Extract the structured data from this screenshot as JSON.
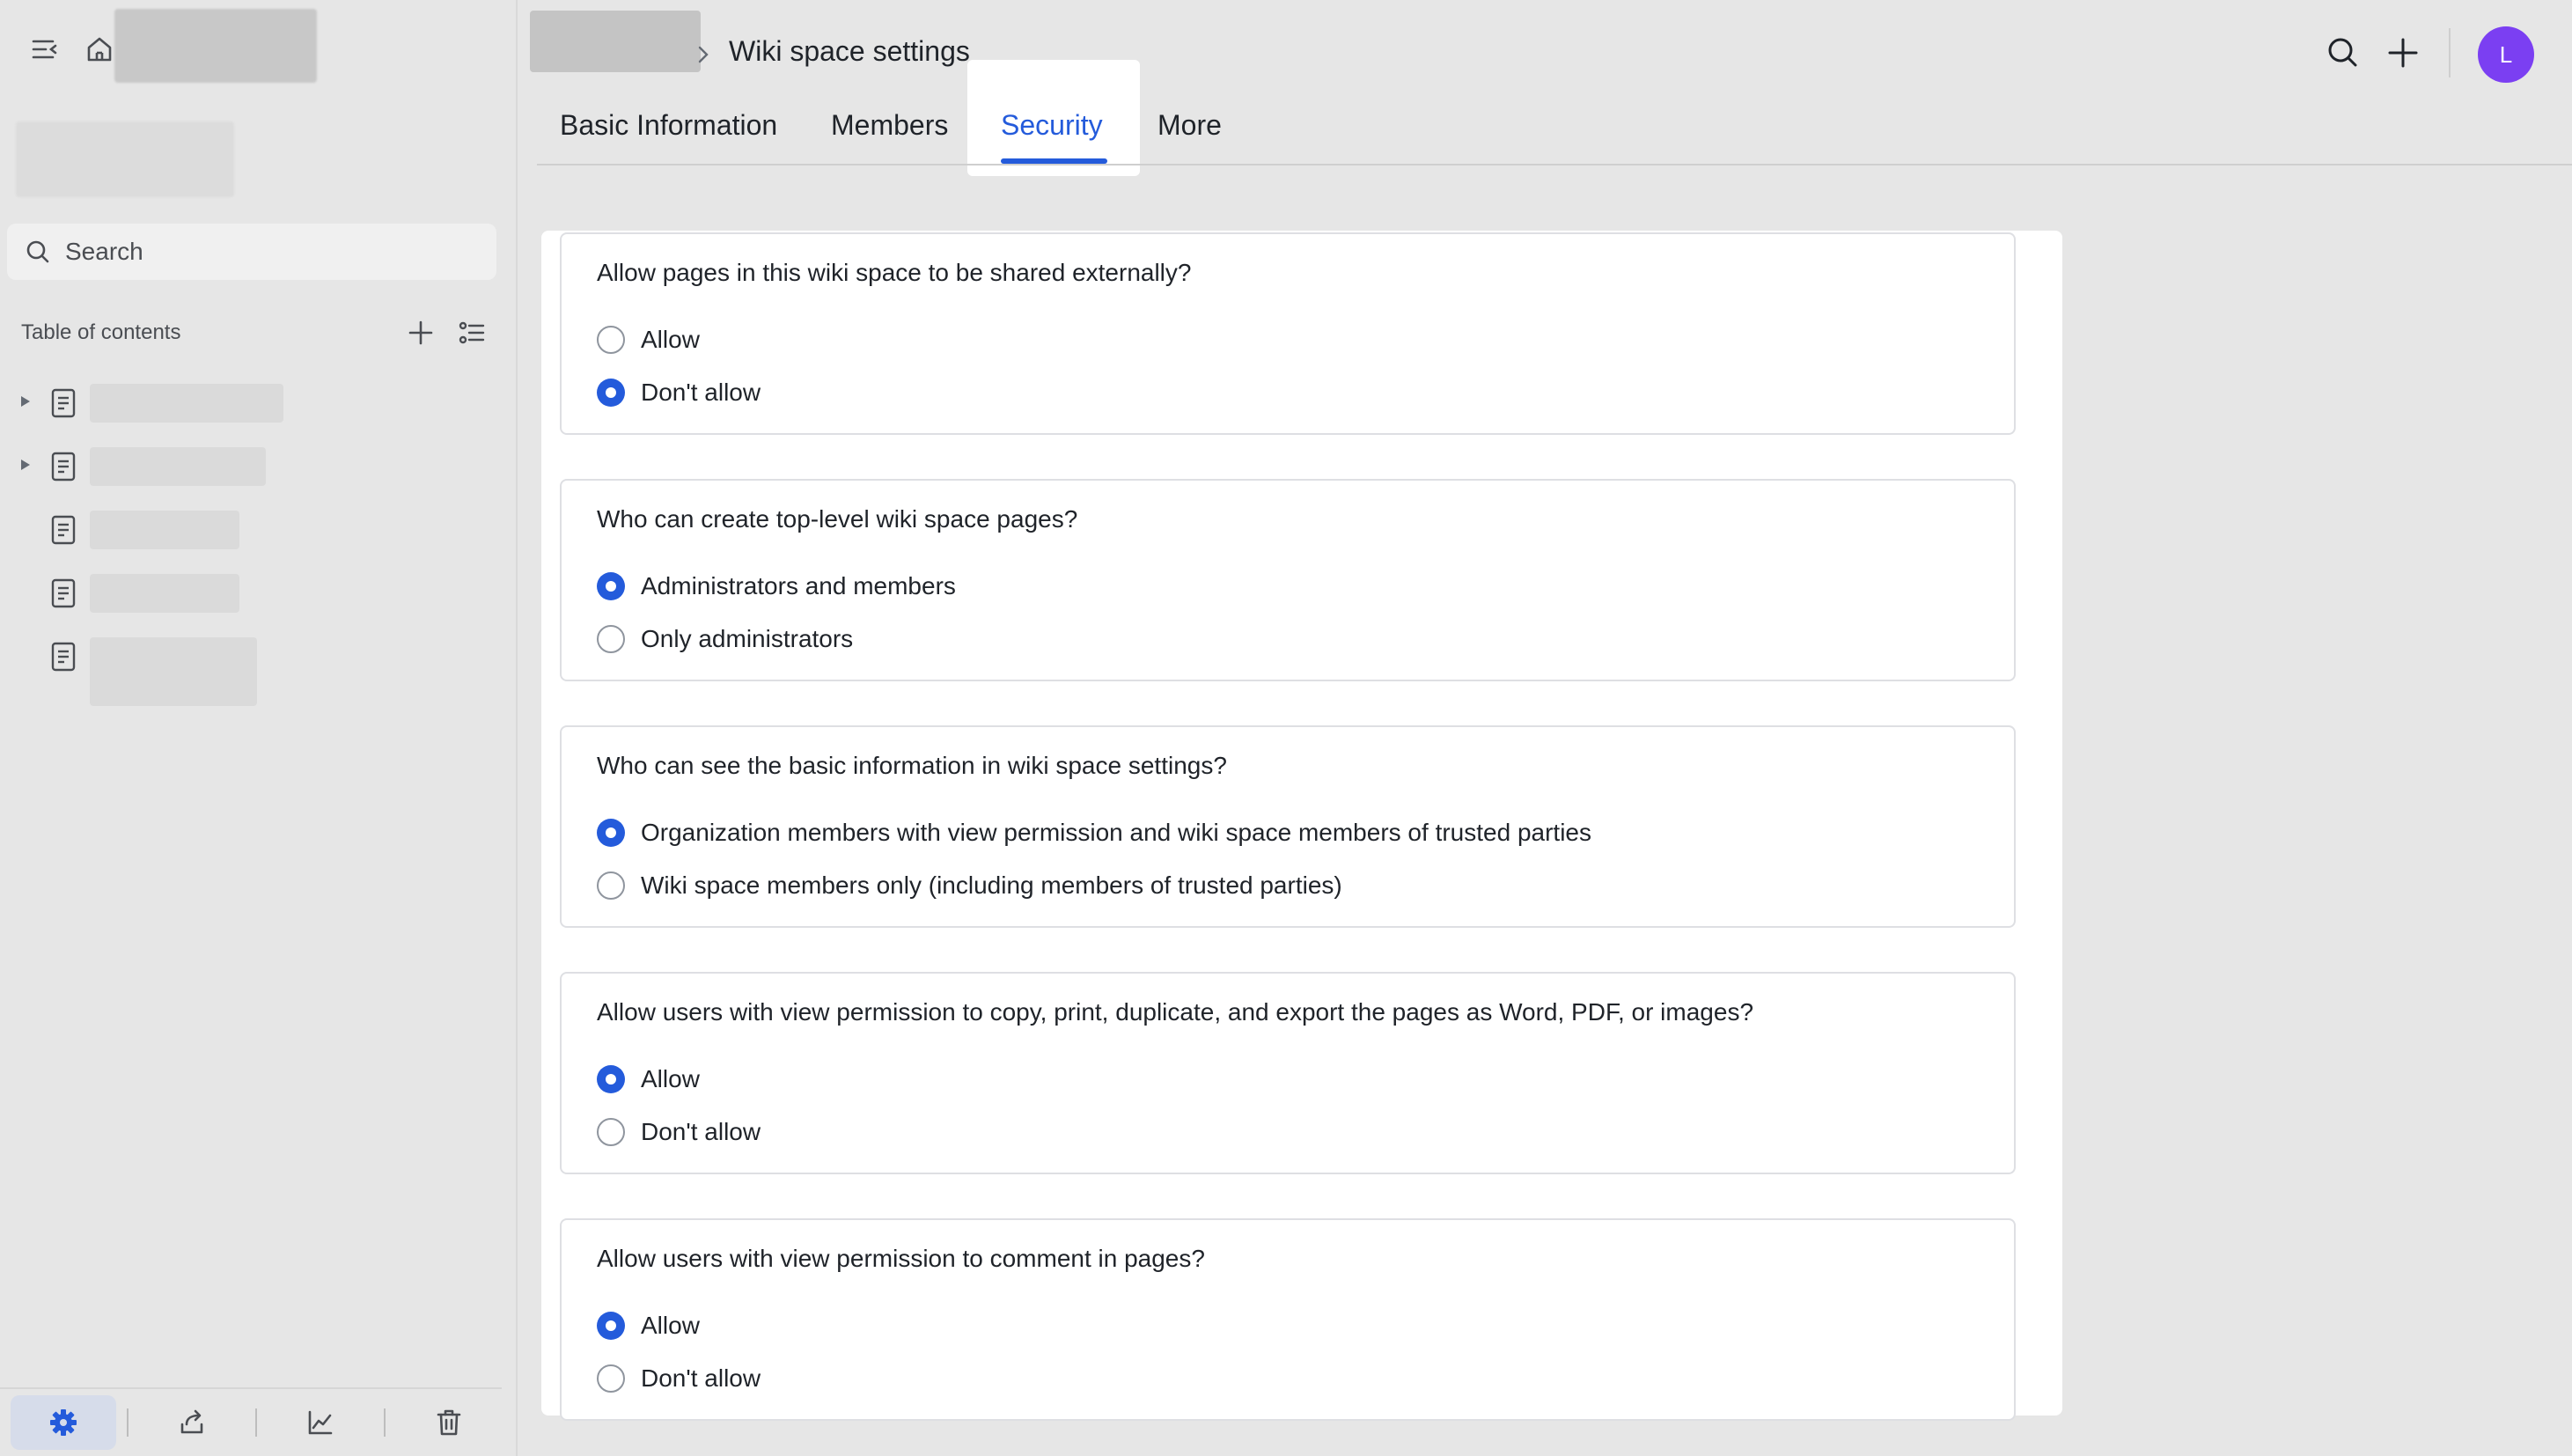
{
  "sidebar": {
    "search_placeholder": "Search",
    "toc_title": "Table of contents",
    "items": [
      {
        "expandable": true
      },
      {
        "expandable": true
      },
      {
        "expandable": false
      },
      {
        "expandable": false
      },
      {
        "expandable": false
      }
    ]
  },
  "header": {
    "title": "Wiki space settings",
    "avatar_initial": "L"
  },
  "tabs": [
    {
      "label": "Basic Information"
    },
    {
      "label": "Members"
    },
    {
      "label": "Security",
      "active": true
    },
    {
      "label": "More"
    }
  ],
  "settings": [
    {
      "question": "Allow pages in this wiki space to be shared externally?",
      "options": [
        {
          "label": "Allow",
          "checked": false
        },
        {
          "label": "Don't allow",
          "checked": true
        }
      ]
    },
    {
      "question": "Who can create top-level wiki space pages?",
      "options": [
        {
          "label": "Administrators and members",
          "checked": true
        },
        {
          "label": "Only administrators",
          "checked": false
        }
      ]
    },
    {
      "question": "Who can see the basic information in wiki space settings?",
      "options": [
        {
          "label": "Organization members with view permission and wiki space members of trusted parties",
          "checked": true
        },
        {
          "label": "Wiki space members only (including members of trusted parties)",
          "checked": false
        }
      ]
    },
    {
      "question": "Allow users with view permission to copy, print, duplicate, and export the pages as Word, PDF, or images?",
      "options": [
        {
          "label": "Allow",
          "checked": true
        },
        {
          "label": "Don't allow",
          "checked": false
        }
      ]
    },
    {
      "question": "Allow users with view permission to comment in pages?",
      "options": [
        {
          "label": "Allow",
          "checked": true
        },
        {
          "label": "Don't allow",
          "checked": false
        }
      ]
    }
  ],
  "colors": {
    "accent": "#245bdb",
    "avatar": "#7b3ff2",
    "background": "#e6e6e6"
  }
}
